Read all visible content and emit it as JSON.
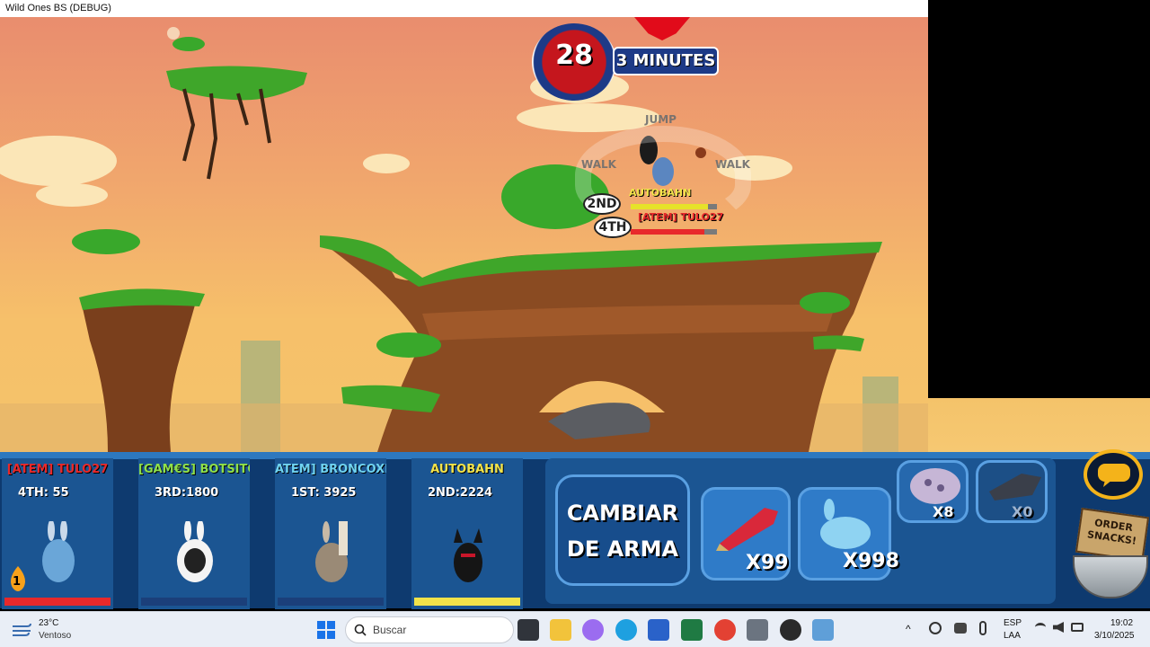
{
  "window": {
    "title": "Wild Ones BS (DEBUG)"
  },
  "timer": {
    "seconds": "28",
    "label": "3 MINUTES"
  },
  "move_controls": {
    "jump": "JUMP",
    "walk_left": "WALK",
    "walk_right": "WALK"
  },
  "field": {
    "rank_2nd": "2ND",
    "rank_4th": "4TH",
    "name_autobahn": "AUTOBAHN",
    "name_tulo": "[ATEM] TULO27",
    "autobahn_health": 0.9,
    "tulo_health": 0.85
  },
  "players": [
    {
      "name": "[ATEM] TULO27",
      "score": "4TH: 55",
      "name_color": "#e8292b",
      "bar_color": "#e8292b",
      "health": 1.0,
      "turn_badge": "1"
    },
    {
      "name": "[GAM€S] BOTSITO",
      "score": "3RD:1800",
      "name_color": "#8fe04a",
      "bar_color": "#1b3f7a",
      "health": 1.0
    },
    {
      "name": "ATEM] BRONCOXD1",
      "score": "1ST: 3925",
      "name_color": "#6fd3f0",
      "bar_color": "#1b3f7a",
      "health": 1.0
    },
    {
      "name": "AUTOBAHN",
      "score": "2ND:2224",
      "name_color": "#f2e34a",
      "bar_color": "#f2e34a",
      "health": 1.0
    }
  ],
  "weapons": {
    "change_weapon": "CAMBIAR DE ARMA",
    "items": [
      {
        "name": "rocket",
        "count": "X99"
      },
      {
        "name": "bunny-bomb",
        "count": "X998"
      },
      {
        "name": "spiked-ball",
        "count": "X8"
      },
      {
        "name": "jet-gun",
        "count": "X0"
      }
    ]
  },
  "snacks": {
    "sign": "ORDER SNACKS!"
  },
  "taskbar": {
    "temperature": "23°C",
    "weather": "Ventoso",
    "search_placeholder": "Buscar",
    "language": "ESP",
    "layout": "LAA",
    "time": "19:02",
    "date": "3/10/2025"
  }
}
